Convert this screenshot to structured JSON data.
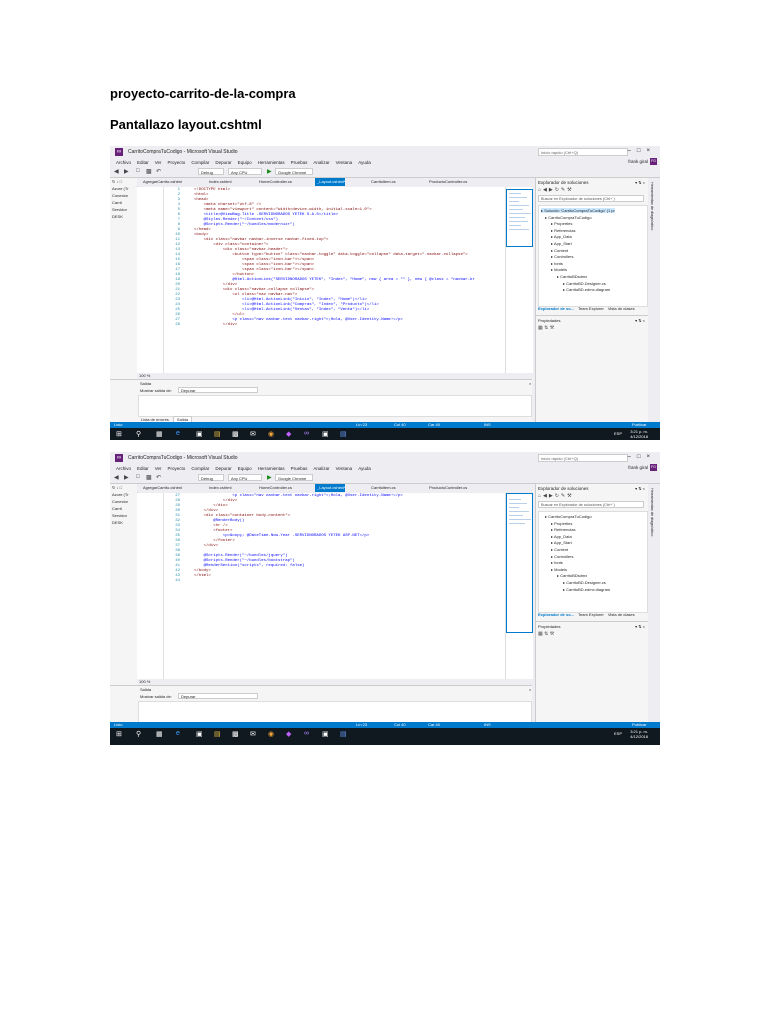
{
  "document": {
    "heading": "proyecto-carrito-de-la-compra",
    "subheading": "Pantallazo layout.cshtml"
  },
  "vs": {
    "window_title": "CarritoCompraTuCodigo - Microsoft Visual Studio",
    "quick_launch": "Inicio rápido (Ctrl+Q)",
    "user": "frank giral",
    "user_badge": "FG",
    "menu": [
      "Archivo",
      "Editar",
      "Ver",
      "Proyecto",
      "Compilar",
      "Depurar",
      "Equipo",
      "Herramientas",
      "Pruebas",
      "Analizar",
      "Ventana",
      "Ayuda"
    ],
    "toolbar": {
      "config": "Debug",
      "platform": "Any CPU",
      "browser": "Google Chrome"
    },
    "left_strip": [
      "Azure (Tr",
      "Conexior",
      "Carrit",
      "Servidor",
      "DESK"
    ],
    "tabs": [
      "AgregarCarrito.cshtml",
      "Index.cshtml",
      "HomeController.cs",
      "_Layout.cshtml*",
      "Carritoltem.cs",
      "ProductoController.cs"
    ],
    "zoom": "100 %",
    "output": {
      "title": "Salida",
      "show_label": "Mostrar salida de:",
      "source": "Depurar",
      "tab_errors": "Lista de errores",
      "tab_output": "Salida"
    },
    "solution_explorer": {
      "title": "Explorador de soluciones",
      "search": "Buscar en Explorador de soluciones (Ctrl+`)",
      "items1": [
        "Solución 'CarritoCompraTuCodigo' (1 pr",
        "CarritoCompraTuCodigo",
        "Properties",
        "Referencias",
        "App_Data",
        "App_Start",
        "Content",
        "Controllers",
        "fonts",
        "Models",
        "CarritoBDsdmx",
        "CarritoBD.Designer.cs",
        "CarritoBD.edmx.diagram"
      ],
      "items2": [
        "CarritoCompraTuCodigo",
        "Properties",
        "Referencias",
        "App_Data",
        "App_Start",
        "Content",
        "Controllers",
        "fonts",
        "Models",
        "CarritoBDsdmx",
        "CarritoBD.Designer.cs",
        "CarritoBD.edmx.diagram"
      ],
      "tabs": [
        "Explorador de so...",
        "Team Explorer",
        "Vista de clases"
      ]
    },
    "properties_title": "Propiedades",
    "side_strip": "Herramientas de diagnóstico",
    "status": {
      "ready": "Listo",
      "ln": "Lín 23",
      "col": "Col 40",
      "car": "Car 40",
      "ins": "INS",
      "publish": "Publicar"
    },
    "clock": {
      "time1": "3:21 p. m.",
      "time2": "3:21 p. m.",
      "date": "4/12/2018",
      "lang": "ESP"
    }
  },
  "code1": [
    {
      "n": "1",
      "t": "<!DOCTYPE html>"
    },
    {
      "n": "2",
      "t": "<html>"
    },
    {
      "n": "3",
      "t": "<head>"
    },
    {
      "n": "4",
      "t": "    <meta charset=\"utf-8\" />"
    },
    {
      "n": "5",
      "t": "    <meta name=\"viewport\" content=\"width=device-width, initial-scale=1.0\">"
    },
    {
      "n": "6",
      "t": "    <title>@ViewBag.Title -SERVIDNORADOS YETEK S.A.S</title>"
    },
    {
      "n": "7",
      "t": "    @Styles.Render(\"~/Content/css\")"
    },
    {
      "n": "8",
      "t": "    @Scripts.Render(\"~/bundles/modernizr\")"
    },
    {
      "n": "9",
      "t": "</head>"
    },
    {
      "n": "10",
      "t": "<body>"
    },
    {
      "n": "11",
      "t": "    <div class=\"navbar navbar-inverse navbar-fixed-top\">"
    },
    {
      "n": "12",
      "t": "        <div class=\"container\">"
    },
    {
      "n": "13",
      "t": "            <div class=\"navbar-header\">"
    },
    {
      "n": "14",
      "t": "                <button type=\"button\" class=\"navbar-toggle\" data-toggle=\"collapse\" data-target=\".navbar-collapse\">"
    },
    {
      "n": "15",
      "t": "                    <span class=\"icon-bar\"></span>"
    },
    {
      "n": "16",
      "t": "                    <span class=\"icon-bar\"></span>"
    },
    {
      "n": "17",
      "t": "                    <span class=\"icon-bar\"></span>"
    },
    {
      "n": "18",
      "t": "                </button>"
    },
    {
      "n": "19",
      "t": "                @Html.ActionLink(\"SERVIDNORADOS YETEK\", \"Index\", \"Home\", new { area = \"\" }, new { @class = \"navbar-br"
    },
    {
      "n": "20",
      "t": "            </div>"
    },
    {
      "n": "21",
      "t": "            <div class=\"navbar-collapse collapse\">"
    },
    {
      "n": "22",
      "t": "                <ul class=\"nav navbar-nav\">"
    },
    {
      "n": "23",
      "t": "                    <li>@Html.ActionLink(\"Inicio\", \"Index\", \"Home\")</li>"
    },
    {
      "n": "24",
      "t": "                    <li>@Html.ActionLink(\"Compras\", \"Index\", \"Producto\")</li>"
    },
    {
      "n": "25",
      "t": "                    <li>@Html.ActionLink(\"Ventas\", \"Index\", \"Venta\")</li>"
    },
    {
      "n": "26",
      "t": "                </ul>"
    },
    {
      "n": "27",
      "t": "                <p class=\"nav navbar-text navbar-right\">¡Hola, @User.Identity.Name!</p>"
    },
    {
      "n": "28",
      "t": "            </div>"
    }
  ],
  "code2": [
    {
      "n": "27",
      "t": "                <p class=\"nav navbar-text navbar-right\">¡Hola, @User.Identity.Name!</p>"
    },
    {
      "n": "28",
      "t": "            </div>"
    },
    {
      "n": "29",
      "t": "        </div>"
    },
    {
      "n": "30",
      "t": "    </div>"
    },
    {
      "n": "31",
      "t": "    <div class=\"container body-content\">"
    },
    {
      "n": "32",
      "t": "        @RenderBody()"
    },
    {
      "n": "33",
      "t": "        <hr />"
    },
    {
      "n": "34",
      "t": "        <footer>"
    },
    {
      "n": "35",
      "t": "            <p>&copy; @DateTime.Now.Year -SERVIDNORADOS YETEK ASP.NET</p>"
    },
    {
      "n": "36",
      "t": "        </footer>"
    },
    {
      "n": "37",
      "t": "    </div>"
    },
    {
      "n": "38",
      "t": ""
    },
    {
      "n": "39",
      "t": "    @Scripts.Render(\"~/bundles/jquery\")"
    },
    {
      "n": "40",
      "t": "    @Scripts.Render(\"~/bundles/bootstrap\")"
    },
    {
      "n": "41",
      "t": "    @RenderSection(\"scripts\", required: false)"
    },
    {
      "n": "42",
      "t": "</body>"
    },
    {
      "n": "43",
      "t": "</html>"
    },
    {
      "n": "44",
      "t": ""
    }
  ]
}
